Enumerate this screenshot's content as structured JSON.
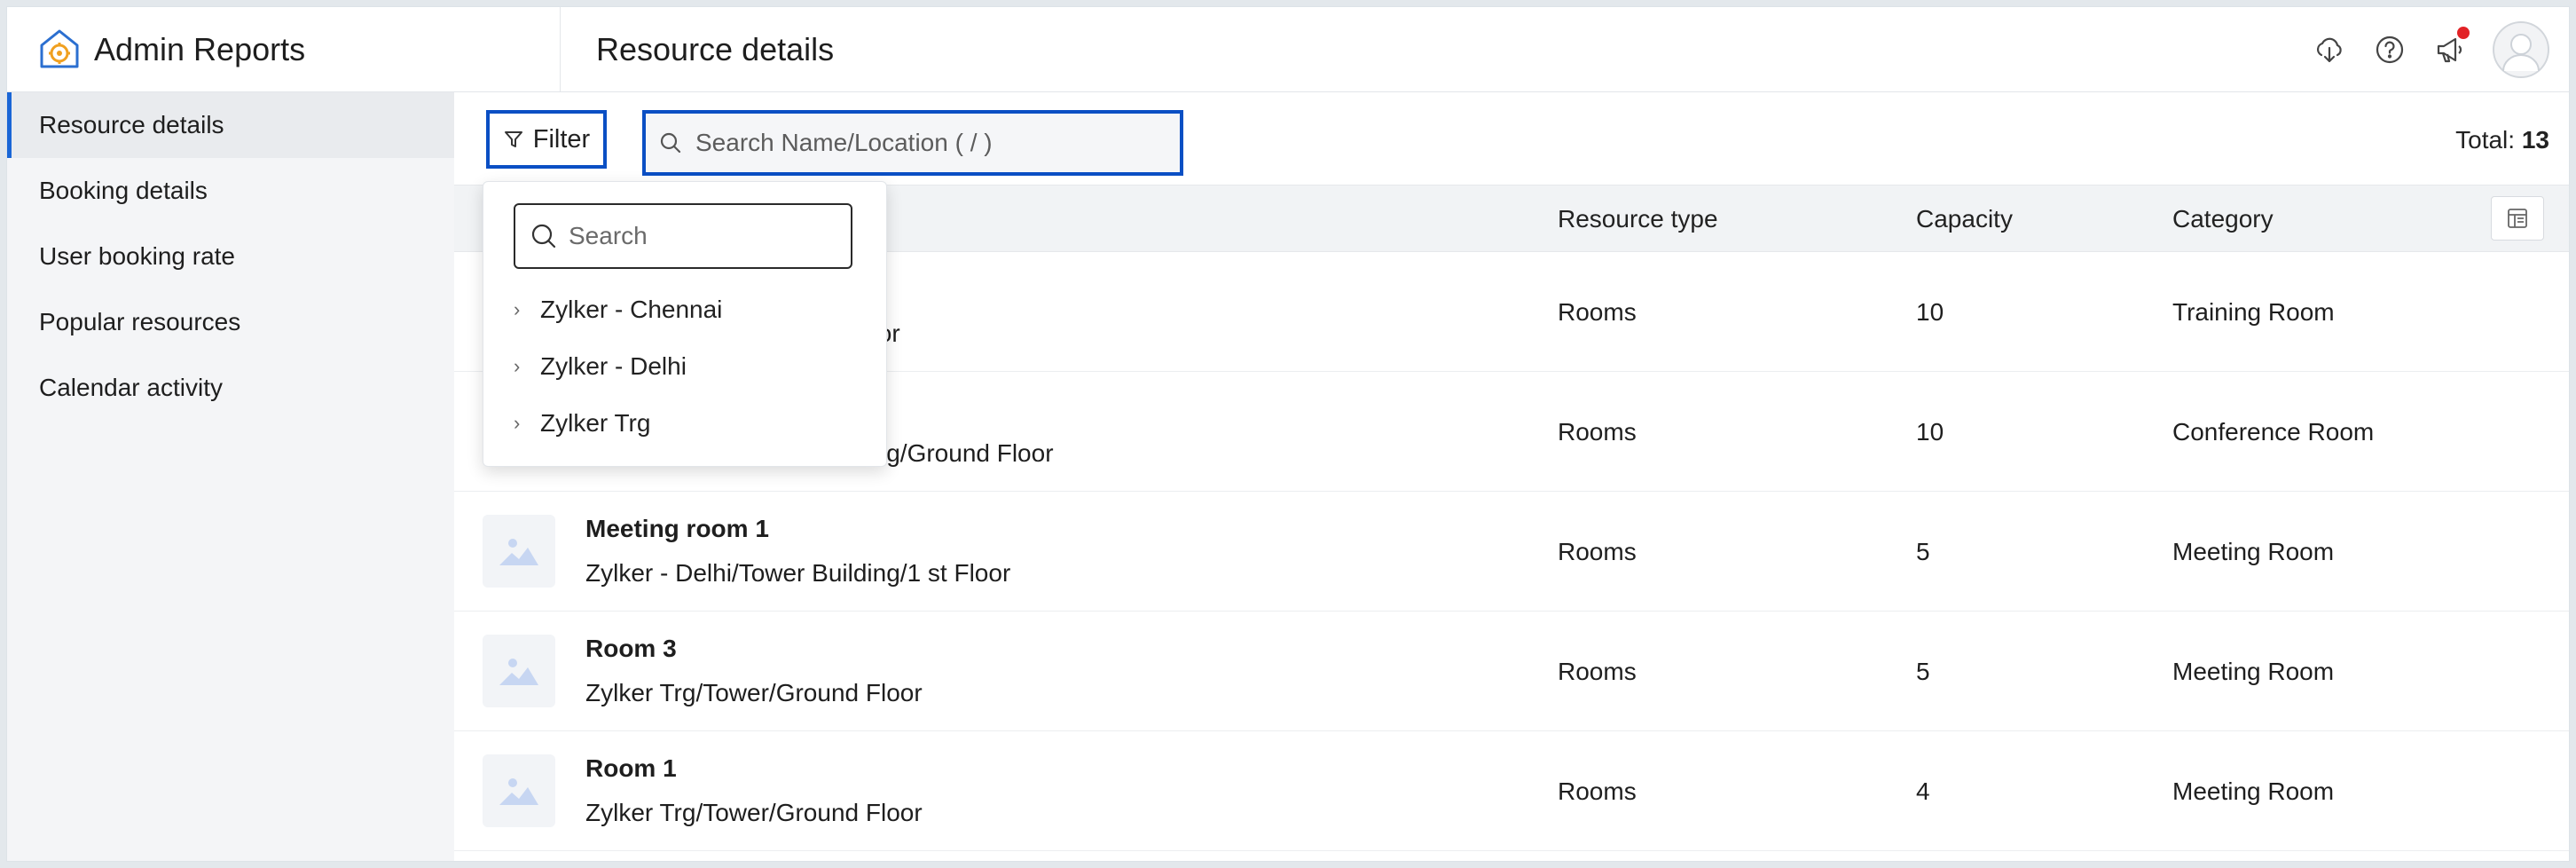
{
  "brand": {
    "name": "Admin Reports"
  },
  "header": {
    "title": "Resource details"
  },
  "sidebar": {
    "items": [
      {
        "label": "Resource details",
        "active": true
      },
      {
        "label": "Booking details"
      },
      {
        "label": "User booking rate"
      },
      {
        "label": "Popular resources"
      },
      {
        "label": "Calendar activity"
      }
    ]
  },
  "toolbar": {
    "filter_label": "Filter",
    "search_placeholder": "Search Name/Location ( / )",
    "total_label": "Total:",
    "total_value": "13"
  },
  "table": {
    "columns": [
      "Resource type",
      "Capacity",
      "Category"
    ],
    "rows": [
      {
        "name": "",
        "location": "Zylker - Chennai/…/Ground Floor",
        "visible_location_fragment": "loor",
        "type": "Rooms",
        "capacity": "10",
        "category": "Training Room"
      },
      {
        "name": "",
        "location": "Zylker - Delhi/Tower Building/Ground Floor",
        "type": "Rooms",
        "capacity": "10",
        "category": "Conference Room"
      },
      {
        "name": "Meeting room 1",
        "location": "Zylker - Delhi/Tower Building/1 st Floor",
        "type": "Rooms",
        "capacity": "5",
        "category": "Meeting Room"
      },
      {
        "name": "Room 3",
        "location": "Zylker Trg/Tower/Ground Floor",
        "type": "Rooms",
        "capacity": "5",
        "category": "Meeting Room"
      },
      {
        "name": "Room 1",
        "location": "Zylker Trg/Tower/Ground Floor",
        "type": "Rooms",
        "capacity": "4",
        "category": "Meeting Room"
      }
    ]
  },
  "filter_popup": {
    "search_placeholder": "Search",
    "items": [
      "Zylker - Chennai",
      "Zylker - Delhi",
      "Zylker Trg"
    ]
  },
  "colors": {
    "accent": "#0a4fc4",
    "notification": "#e22226"
  }
}
